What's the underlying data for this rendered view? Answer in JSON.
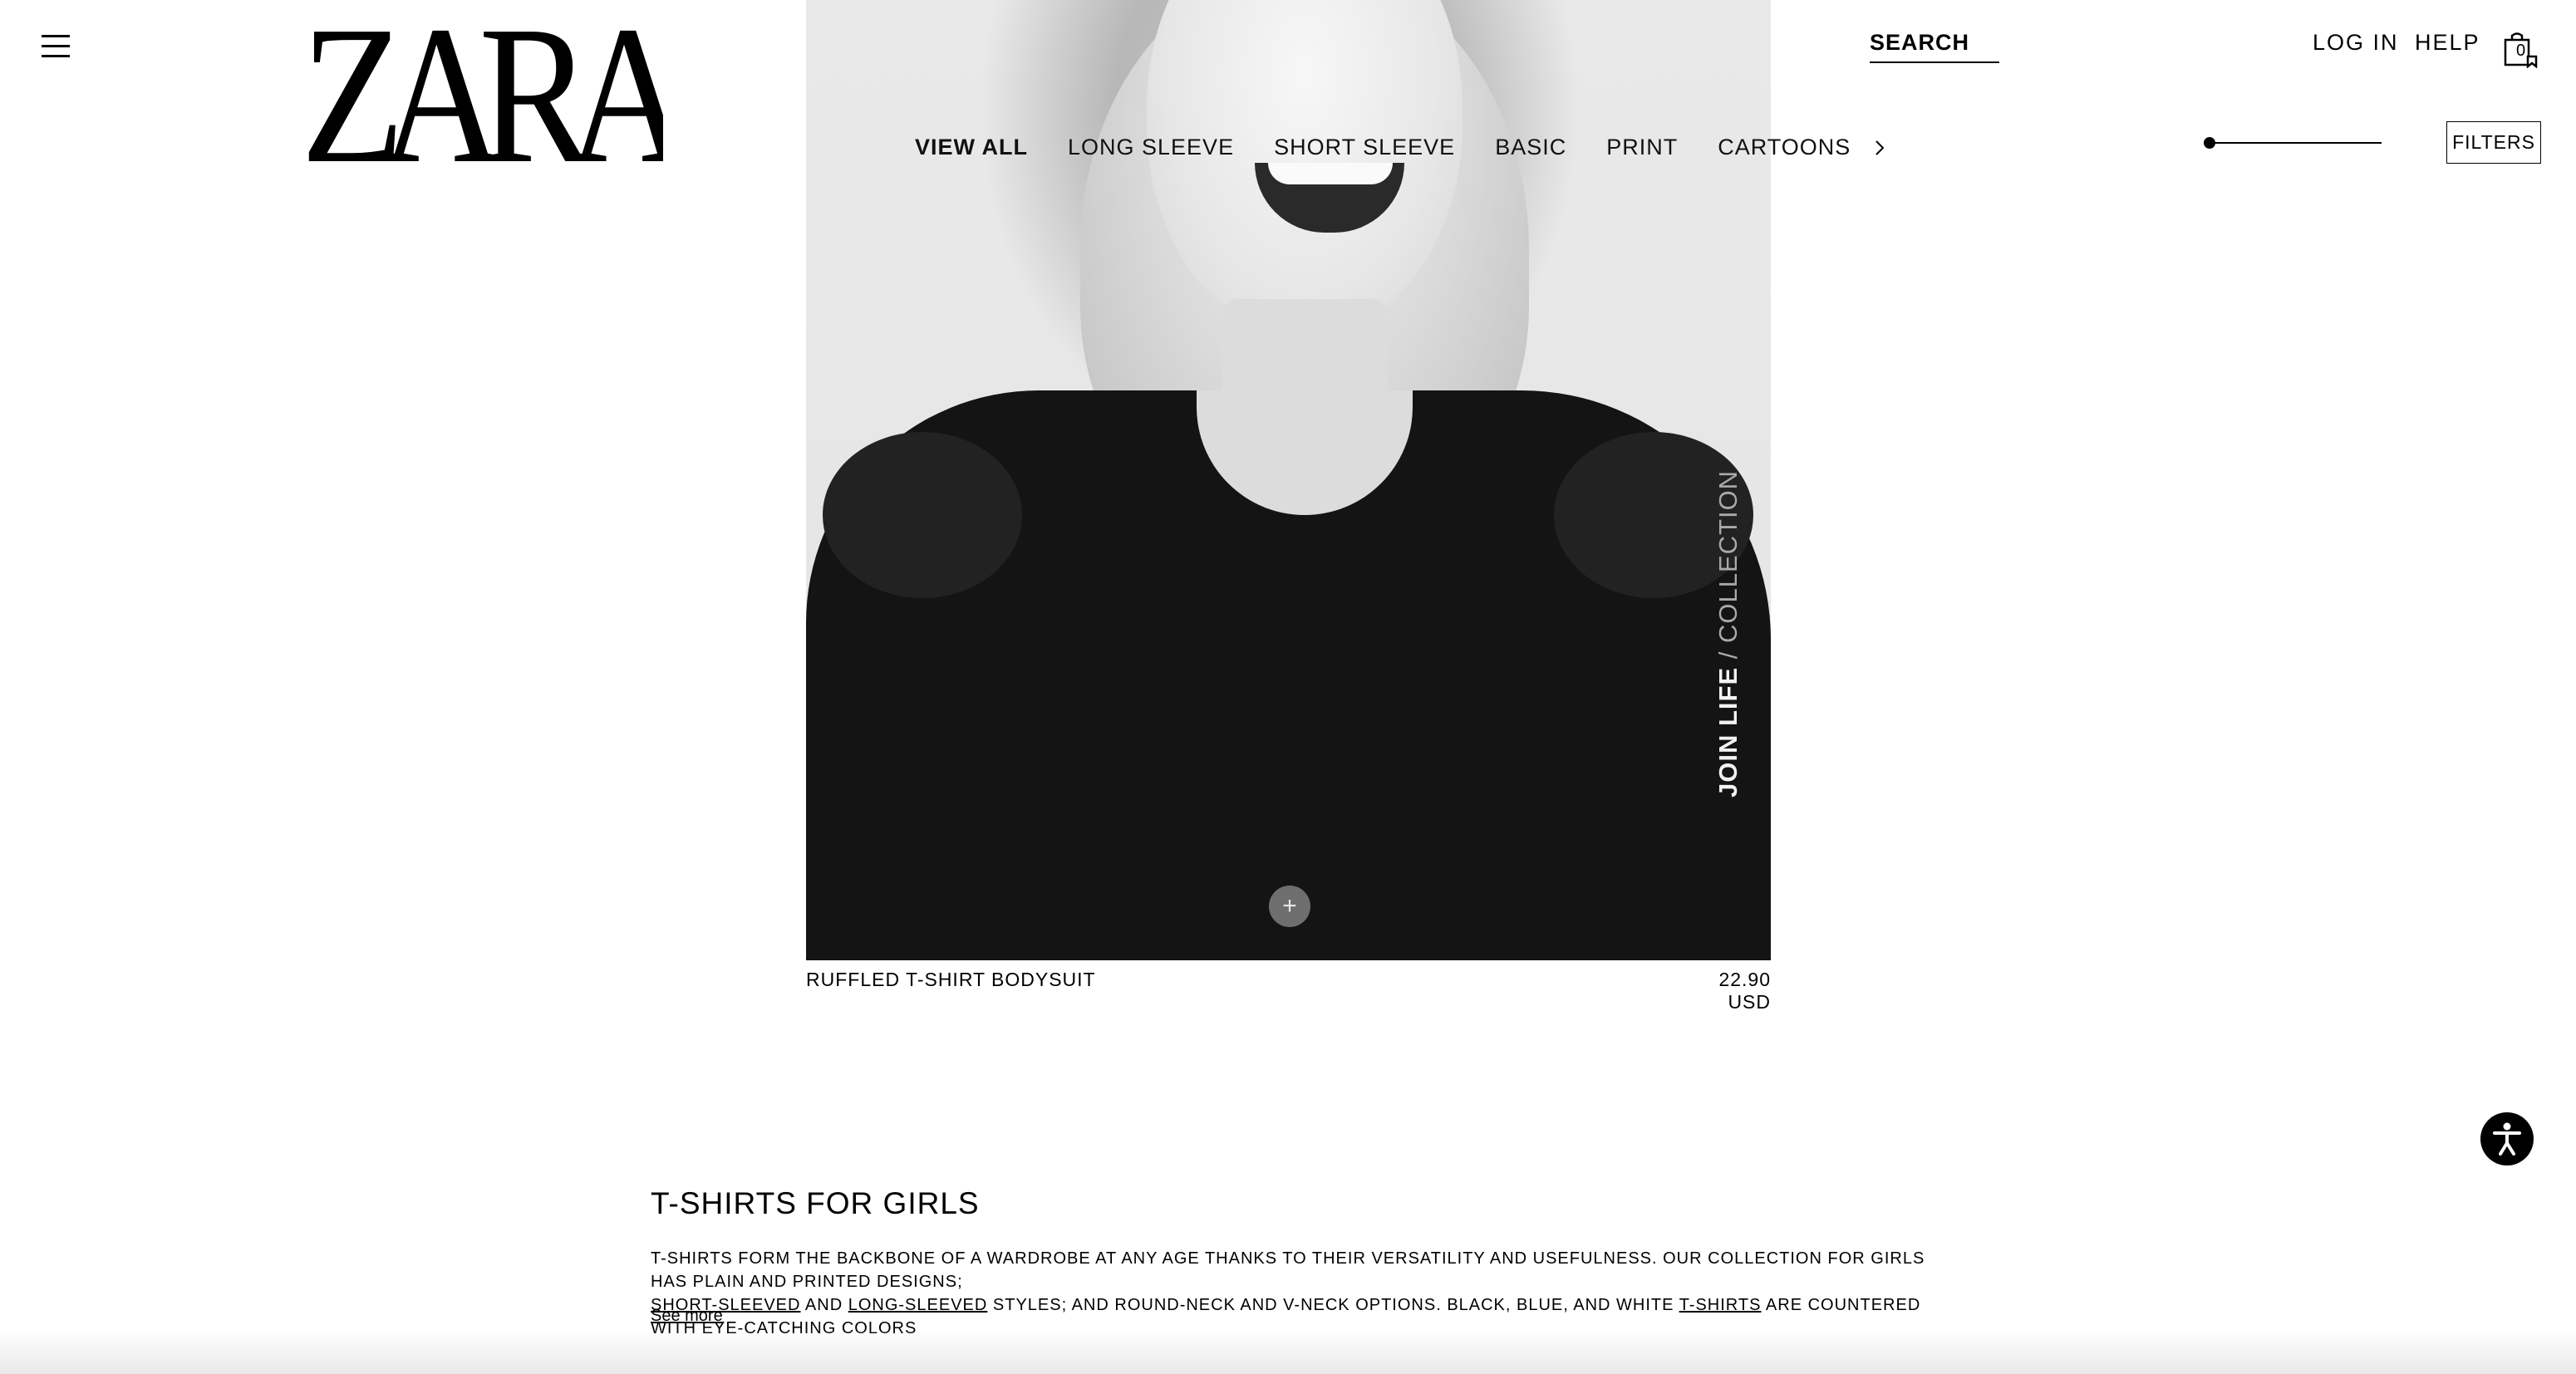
{
  "header": {
    "logo_text": "ZARA",
    "search_label": "SEARCH",
    "login_label": "LOG IN",
    "help_label": "HELP",
    "cart_count": "0"
  },
  "category_nav": {
    "items": [
      {
        "label": "VIEW ALL",
        "active": true
      },
      {
        "label": "LONG SLEEVE",
        "active": false
      },
      {
        "label": "SHORT SLEEVE",
        "active": false
      },
      {
        "label": "BASIC",
        "active": false
      },
      {
        "label": "PRINT",
        "active": false
      },
      {
        "label": "CARTOONS",
        "active": false
      }
    ]
  },
  "toolbar": {
    "filters_label": "FILTERS",
    "zoom_level": 0
  },
  "product": {
    "overlay_bold": "JOIN LIFE",
    "overlay_light": " / COLLECTION",
    "name": "RUFFLED T-SHIRT BODYSUIT",
    "price": "22.90 USD",
    "add_symbol": "+"
  },
  "description": {
    "title": "T-SHIRTS FOR GIRLS",
    "line1": "T-SHIRTS FORM THE BACKBONE OF A WARDROBE AT ANY AGE THANKS TO THEIR VERSATILITY AND USEFULNESS. OUR COLLECTION FOR GIRLS HAS PLAIN AND PRINTED DESIGNS;",
    "link_short": "SHORT-SLEEVED",
    "text_and": " AND ",
    "link_long": "LONG-SLEEVED",
    "text_mid": " STYLES; AND ROUND-NECK AND V-NECK OPTIONS. BLACK, BLUE, AND WHITE ",
    "link_tshirts": "T-SHIRTS",
    "text_end": " ARE COUNTERED WITH EYE-CATCHING COLORS",
    "see_more": "See more"
  },
  "colors": {
    "text": "#000000",
    "background": "#ffffff",
    "shirt": "#141414"
  },
  "icons": [
    "hamburger-menu-icon",
    "shopping-bag-icon",
    "chevron-right-icon",
    "plus-icon",
    "accessibility-icon"
  ]
}
